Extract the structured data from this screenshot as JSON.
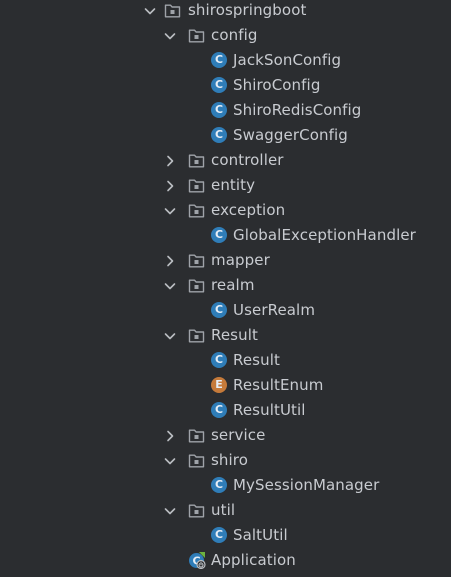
{
  "tree": [
    {
      "id": "shirospringboot",
      "label": "shirospringboot",
      "depth": 0,
      "kind": "folder",
      "state": "expanded",
      "icon": "package-icon"
    },
    {
      "id": "config",
      "label": "config",
      "depth": 1,
      "kind": "folder",
      "state": "expanded",
      "icon": "package-icon"
    },
    {
      "id": "jacksonconfig",
      "label": "JackSonConfig",
      "depth": 2,
      "kind": "class",
      "icon": "class-icon"
    },
    {
      "id": "shiroconfig",
      "label": "ShiroConfig",
      "depth": 2,
      "kind": "class",
      "icon": "class-icon"
    },
    {
      "id": "shiroredisconfig",
      "label": "ShiroRedisConfig",
      "depth": 2,
      "kind": "class",
      "icon": "class-icon"
    },
    {
      "id": "swaggerconfig",
      "label": "SwaggerConfig",
      "depth": 2,
      "kind": "class",
      "icon": "class-icon"
    },
    {
      "id": "controller",
      "label": "controller",
      "depth": 1,
      "kind": "folder",
      "state": "collapsed",
      "icon": "package-icon"
    },
    {
      "id": "entity",
      "label": "entity",
      "depth": 1,
      "kind": "folder",
      "state": "collapsed",
      "icon": "package-icon"
    },
    {
      "id": "exception",
      "label": "exception",
      "depth": 1,
      "kind": "folder",
      "state": "expanded",
      "icon": "package-icon"
    },
    {
      "id": "globalexceptionhandler",
      "label": "GlobalExceptionHandler",
      "depth": 2,
      "kind": "class",
      "icon": "class-icon"
    },
    {
      "id": "mapper",
      "label": "mapper",
      "depth": 1,
      "kind": "folder",
      "state": "collapsed",
      "icon": "package-icon"
    },
    {
      "id": "realm",
      "label": "realm",
      "depth": 1,
      "kind": "folder",
      "state": "expanded",
      "icon": "package-icon"
    },
    {
      "id": "userrealm",
      "label": "UserRealm",
      "depth": 2,
      "kind": "class",
      "icon": "class-icon"
    },
    {
      "id": "result-pkg",
      "label": "Result",
      "depth": 1,
      "kind": "folder",
      "state": "expanded",
      "icon": "package-icon"
    },
    {
      "id": "result",
      "label": "Result",
      "depth": 2,
      "kind": "class",
      "icon": "class-icon"
    },
    {
      "id": "resultenum",
      "label": "ResultEnum",
      "depth": 2,
      "kind": "enum",
      "icon": "enum-icon"
    },
    {
      "id": "resultutil",
      "label": "ResultUtil",
      "depth": 2,
      "kind": "class",
      "icon": "class-icon"
    },
    {
      "id": "service",
      "label": "service",
      "depth": 1,
      "kind": "folder",
      "state": "collapsed",
      "icon": "package-icon"
    },
    {
      "id": "shiro",
      "label": "shiro",
      "depth": 1,
      "kind": "folder",
      "state": "expanded",
      "icon": "package-icon"
    },
    {
      "id": "mysessionmanager",
      "label": "MySessionManager",
      "depth": 2,
      "kind": "class",
      "icon": "class-icon"
    },
    {
      "id": "util",
      "label": "util",
      "depth": 1,
      "kind": "folder",
      "state": "expanded",
      "icon": "package-icon"
    },
    {
      "id": "saltutil",
      "label": "SaltUtil",
      "depth": 2,
      "kind": "class",
      "icon": "class-icon"
    },
    {
      "id": "application",
      "label": "Application",
      "depth": 1,
      "kind": "app",
      "icon": "spring-boot-application-icon"
    }
  ],
  "class_glyph": "C",
  "enum_glyph": "E",
  "colors": {
    "background": "#2b2d30",
    "text": "#c8cbd0",
    "chevron": "#b9bcc1",
    "folder": "#9fa3a9",
    "class_badge": "#2f7db8",
    "enum_badge": "#c57a3a",
    "spring_green": "#6db33f"
  }
}
